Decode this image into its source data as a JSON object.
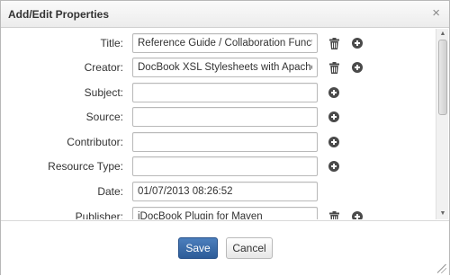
{
  "dialog": {
    "title": "Add/Edit Properties",
    "close_label": "×"
  },
  "fields": [
    {
      "label": "Title:",
      "value": "Reference Guide / Collaboration Functions",
      "has_delete": true,
      "has_add": true
    },
    {
      "label": "Creator:",
      "value": "DocBook XSL Stylesheets with Apache FOP",
      "has_delete": true,
      "has_add": true
    },
    {
      "label": "Subject:",
      "value": "",
      "has_delete": false,
      "has_add": true
    },
    {
      "label": "Source:",
      "value": "",
      "has_delete": false,
      "has_add": true
    },
    {
      "label": "Contributor:",
      "value": "",
      "has_delete": false,
      "has_add": true
    },
    {
      "label": "Resource Type:",
      "value": "",
      "has_delete": false,
      "has_add": true
    },
    {
      "label": "Date:",
      "value": "01/07/2013 08:26:52",
      "has_delete": false,
      "has_add": false
    },
    {
      "label": "Publisher:",
      "value": "jDocBook Plugin for Maven",
      "has_delete": true,
      "has_add": true
    }
  ],
  "footer": {
    "save_label": "Save",
    "cancel_label": "Cancel"
  },
  "colors": {
    "primary_button": "#3a6aa8",
    "icon": "#4a4a4a"
  },
  "icons": {
    "delete": "trash-icon",
    "add": "plus-circle-icon",
    "close": "close-icon"
  }
}
